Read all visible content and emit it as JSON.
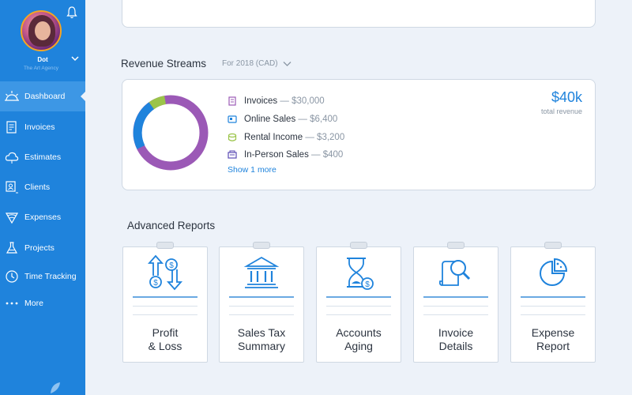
{
  "user": {
    "name": "Dot",
    "org": "The Art Agency"
  },
  "nav": [
    {
      "label": "Dashboard",
      "icon": "dashboard-sun-icon",
      "active": true
    },
    {
      "label": "Invoices",
      "icon": "invoices-icon"
    },
    {
      "label": "Estimates",
      "icon": "estimates-icon"
    },
    {
      "label": "Clients",
      "icon": "clients-icon"
    },
    {
      "label": "Expenses",
      "icon": "expenses-icon"
    },
    {
      "label": "Projects",
      "icon": "projects-icon"
    },
    {
      "label": "Time Tracking",
      "icon": "clock-icon"
    },
    {
      "label": "More",
      "icon": "more-dots-icon"
    }
  ],
  "revenue": {
    "title": "Revenue Streams",
    "period": "For 2018 (CAD)",
    "total": "$40k",
    "total_label": "total revenue",
    "show_more": "Show 1 more",
    "streams": [
      {
        "label": "Invoices",
        "amount": "— $30,000",
        "color": "#9b59b6"
      },
      {
        "label": "Online Sales",
        "amount": "— $6,400",
        "color": "#1f83dc"
      },
      {
        "label": "Rental Income",
        "amount": "— $3,200",
        "color": "#9bc44a"
      },
      {
        "label": "In-Person Sales",
        "amount": "— $400",
        "color": "#5b4bb3"
      }
    ]
  },
  "reports": {
    "title": "Advanced Reports",
    "items": [
      {
        "label": "Profit\n& Loss",
        "icon": "profit-loss-icon"
      },
      {
        "label": "Sales Tax\nSummary",
        "icon": "bank-icon"
      },
      {
        "label": "Accounts\nAging",
        "icon": "hourglass-icon"
      },
      {
        "label": "Invoice\nDetails",
        "icon": "invoice-search-icon"
      },
      {
        "label": "Expense\nReport",
        "icon": "pie-chart-icon"
      }
    ]
  },
  "colors": {
    "sidebar": "#1f83dc",
    "accent": "#1f83dc",
    "background": "#edf2f9"
  }
}
